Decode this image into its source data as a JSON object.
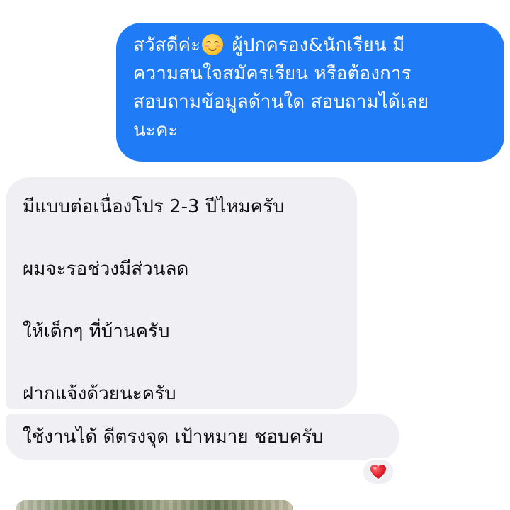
{
  "messages": {
    "outgoing": {
      "text_before_emoji": "สวัสดีค่ะ",
      "emoji": "smiling-face",
      "text_after_emoji": " ผู้ปกครอง&นักเรียน มี\nความสนใจสมัครเรียน หรือต้องการ\nสอบถามข้อมูลด้านใด สอบถามได้เลย\nนะคะ"
    },
    "incoming": [
      {
        "lines": [
          "มีแบบต่อเนื่องโปร 2-3 ปีไหมครับ",
          "ผมจะรอช่วงมีส่วนลด",
          "ให้เด็กๆ ที่บ้านครับ",
          "ฝากแจ้งด้วยนะครับ"
        ]
      },
      {
        "text": "ใช้งานได้ ดีตรงจุด เป้าหมาย ชอบครับ"
      }
    ],
    "reaction": {
      "icon": "heart-icon",
      "color": "#e3252f"
    }
  },
  "colors": {
    "outgoing_bubble": "#1f7cf6",
    "incoming_bubble": "#efeff4",
    "background": "#ffffff"
  }
}
